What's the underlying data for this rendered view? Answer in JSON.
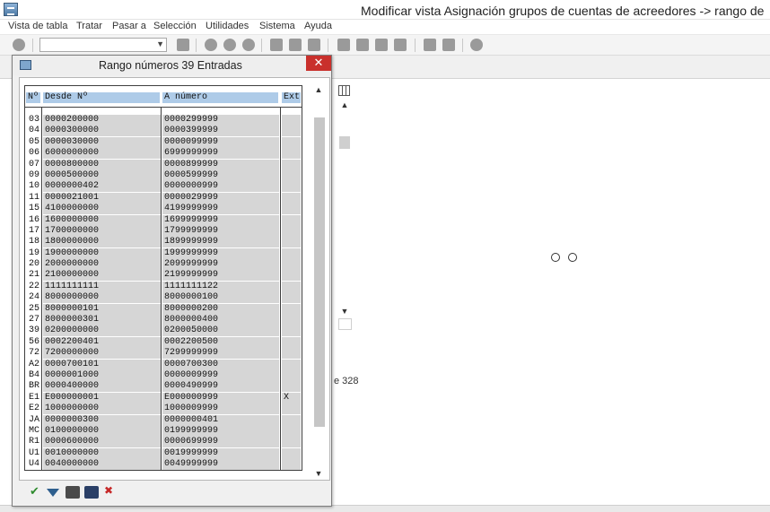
{
  "window": {
    "title": "Modificar vista Asignación grupos de cuentas de acreedores -> rango de"
  },
  "menu": [
    "Vista de tabla",
    "Tratar",
    "Pasar a",
    "Selección",
    "Utilidades",
    "Sistema",
    "Ayuda"
  ],
  "toolbar": {
    "command_field_value": ""
  },
  "background": {
    "partial_text": "e 328"
  },
  "dialog": {
    "title": "Rango números 39 Entradas",
    "close_label": "✕",
    "columns": [
      "Nº",
      "Desde Nº",
      "A número",
      "Ext"
    ],
    "rows": [
      [
        "03",
        "0000200000",
        "0000299999",
        ""
      ],
      [
        "04",
        "0000300000",
        "0000399999",
        ""
      ],
      [
        "05",
        "0000030000",
        "0000099999",
        ""
      ],
      [
        "06",
        "6000000000",
        "6999999999",
        ""
      ],
      [
        "07",
        "0000800000",
        "0000899999",
        ""
      ],
      [
        "09",
        "0000500000",
        "0000599999",
        ""
      ],
      [
        "10",
        "0000000402",
        "0000000999",
        ""
      ],
      [
        "11",
        "0000021001",
        "0000029999",
        ""
      ],
      [
        "15",
        "4100000000",
        "4199999999",
        ""
      ],
      [
        "16",
        "1600000000",
        "1699999999",
        ""
      ],
      [
        "17",
        "1700000000",
        "1799999999",
        ""
      ],
      [
        "18",
        "1800000000",
        "1899999999",
        ""
      ],
      [
        "19",
        "1900000000",
        "1999999999",
        ""
      ],
      [
        "20",
        "2000000000",
        "2099999999",
        ""
      ],
      [
        "21",
        "2100000000",
        "2199999999",
        ""
      ],
      [
        "22",
        "1111111111",
        "1111111122",
        ""
      ],
      [
        "24",
        "8000000000",
        "8000000100",
        ""
      ],
      [
        "25",
        "8000000101",
        "8000000200",
        ""
      ],
      [
        "27",
        "8000000301",
        "8000000400",
        ""
      ],
      [
        "39",
        "0200000000",
        "0200050000",
        ""
      ],
      [
        "56",
        "0002200401",
        "0002200500",
        ""
      ],
      [
        "72",
        "7200000000",
        "7299999999",
        ""
      ],
      [
        "A2",
        "0000700101",
        "0000700300",
        ""
      ],
      [
        "B4",
        "0000001000",
        "0000009999",
        ""
      ],
      [
        "BR",
        "0000400000",
        "0000490999",
        ""
      ],
      [
        "E1",
        "E000000001",
        "E000000999",
        "X"
      ],
      [
        "E2",
        "1000000000",
        "1000009999",
        ""
      ],
      [
        "JA",
        "0000000300",
        "0000000401",
        ""
      ],
      [
        "MC",
        "0100000000",
        "0199999999",
        ""
      ],
      [
        "R1",
        "0000600000",
        "0000699999",
        ""
      ],
      [
        "U1",
        "0010000000",
        "0019999999",
        ""
      ],
      [
        "U4",
        "0040000000",
        "0049999999",
        ""
      ]
    ]
  },
  "icons": {
    "confirm": "check-icon",
    "filter": "filter-icon",
    "print": "print-icon",
    "find": "find-icon",
    "cancel": "cancel-icon"
  },
  "colors": {
    "header_highlight": "#aecbe8",
    "close_button": "#c9302c",
    "row_shade": "#d6d6d6"
  }
}
